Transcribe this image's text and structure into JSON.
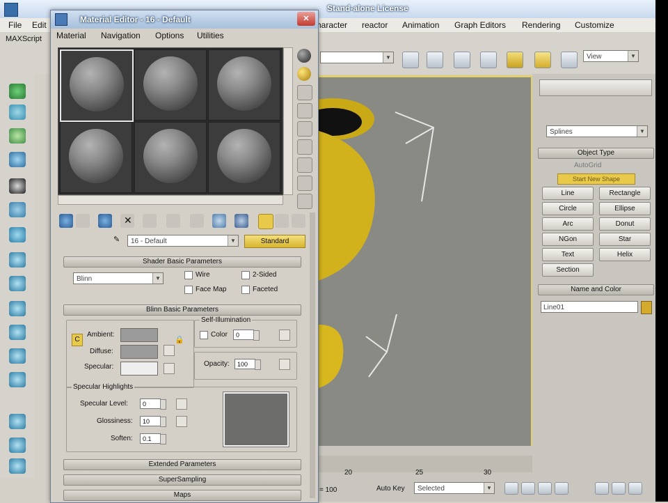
{
  "app": {
    "title": "Stand-alone License",
    "menu": [
      "File",
      "Edit",
      "haracter",
      "reactor",
      "Animation",
      "Graph Editors",
      "Rendering",
      "Customize"
    ],
    "maxscript_label": "MAXScript",
    "view_dropdown": "View"
  },
  "material_editor": {
    "title": "Material Editor - 16 - Default",
    "menu": [
      "Material",
      "Navigation",
      "Options",
      "Utilities"
    ],
    "material_name": "16 - Default",
    "material_type_button": "Standard",
    "shader_basic": {
      "header": "Shader Basic Parameters",
      "shader": "Blinn",
      "wire": "Wire",
      "two_sided": "2-Sided",
      "face_map": "Face Map",
      "faceted": "Faceted"
    },
    "blinn_basic": {
      "header": "Blinn Basic Parameters",
      "self_illumination": "Self-Illumination",
      "color_label": "Color",
      "color_value": "0",
      "ambient": "Ambient:",
      "diffuse": "Diffuse:",
      "specular": "Specular:",
      "opacity_label": "Opacity:",
      "opacity_value": "100",
      "lock_label": "C"
    },
    "specular_highlights": {
      "header": "Specular Highlights",
      "specular_level_label": "Specular Level:",
      "specular_level_value": "0",
      "glossiness_label": "Glossiness:",
      "glossiness_value": "10",
      "soften_label": "Soften:",
      "soften_value": "0.1"
    },
    "rollouts": [
      "Extended Parameters",
      "SuperSampling",
      "Maps"
    ]
  },
  "command_panel": {
    "category_dropdown": "Splines",
    "object_type_header": "Object Type",
    "autogrid": "AutoGrid",
    "start_new_shape": "Start New Shape",
    "buttons": [
      "Line",
      "Rectangle",
      "Circle",
      "Ellipse",
      "Arc",
      "Donut",
      "NGon",
      "Star",
      "Text",
      "Helix",
      "Section"
    ],
    "name_color_header": "Name and Color",
    "object_name": "Line01"
  },
  "timeline": {
    "ticks": [
      "20",
      "25",
      "30"
    ],
    "coord": "= 100",
    "auto_key": "Auto Key",
    "selected": "Selected"
  },
  "colors": {
    "accent_yellow": "#e8c94a",
    "viewport_bg": "#8a8a84",
    "object_yellow": "#d2b21c"
  }
}
